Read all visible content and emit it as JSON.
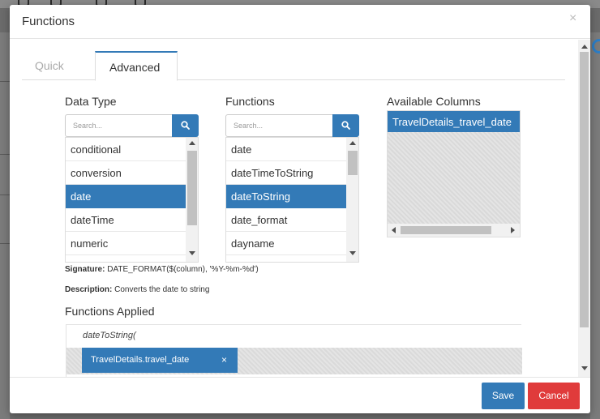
{
  "modal": {
    "title": "Functions",
    "close_glyph": "×"
  },
  "tabs": [
    {
      "label": "Quick",
      "active": false
    },
    {
      "label": "Advanced",
      "active": true
    }
  ],
  "data_type": {
    "title": "Data Type",
    "search_placeholder": "Search...",
    "items": [
      "conditional",
      "conversion",
      "date",
      "dateTime",
      "numeric"
    ],
    "selected": "date"
  },
  "functions": {
    "title": "Functions",
    "search_placeholder": "Search...",
    "items": [
      "date",
      "dateTimeToString",
      "dateToString",
      "date_format",
      "dayname"
    ],
    "selected": "dateToString"
  },
  "available_columns": {
    "title": "Available Columns",
    "items": [
      "TravelDetails_travel_date"
    ]
  },
  "signature": {
    "label": "Signature:",
    "value": "DATE_FORMAT($(column), '%Y-%m-%d')"
  },
  "description": {
    "label": "Description:",
    "value": "Converts the date to string"
  },
  "applied": {
    "title": "Functions Applied",
    "function_text": "dateToString(",
    "tags": [
      {
        "label": "TravelDetails.travel_date",
        "remove_glyph": "×"
      }
    ]
  },
  "footer": {
    "save_label": "Save",
    "cancel_label": "Cancel"
  },
  "colors": {
    "accent": "#337ab7",
    "danger": "#e03b3b"
  }
}
